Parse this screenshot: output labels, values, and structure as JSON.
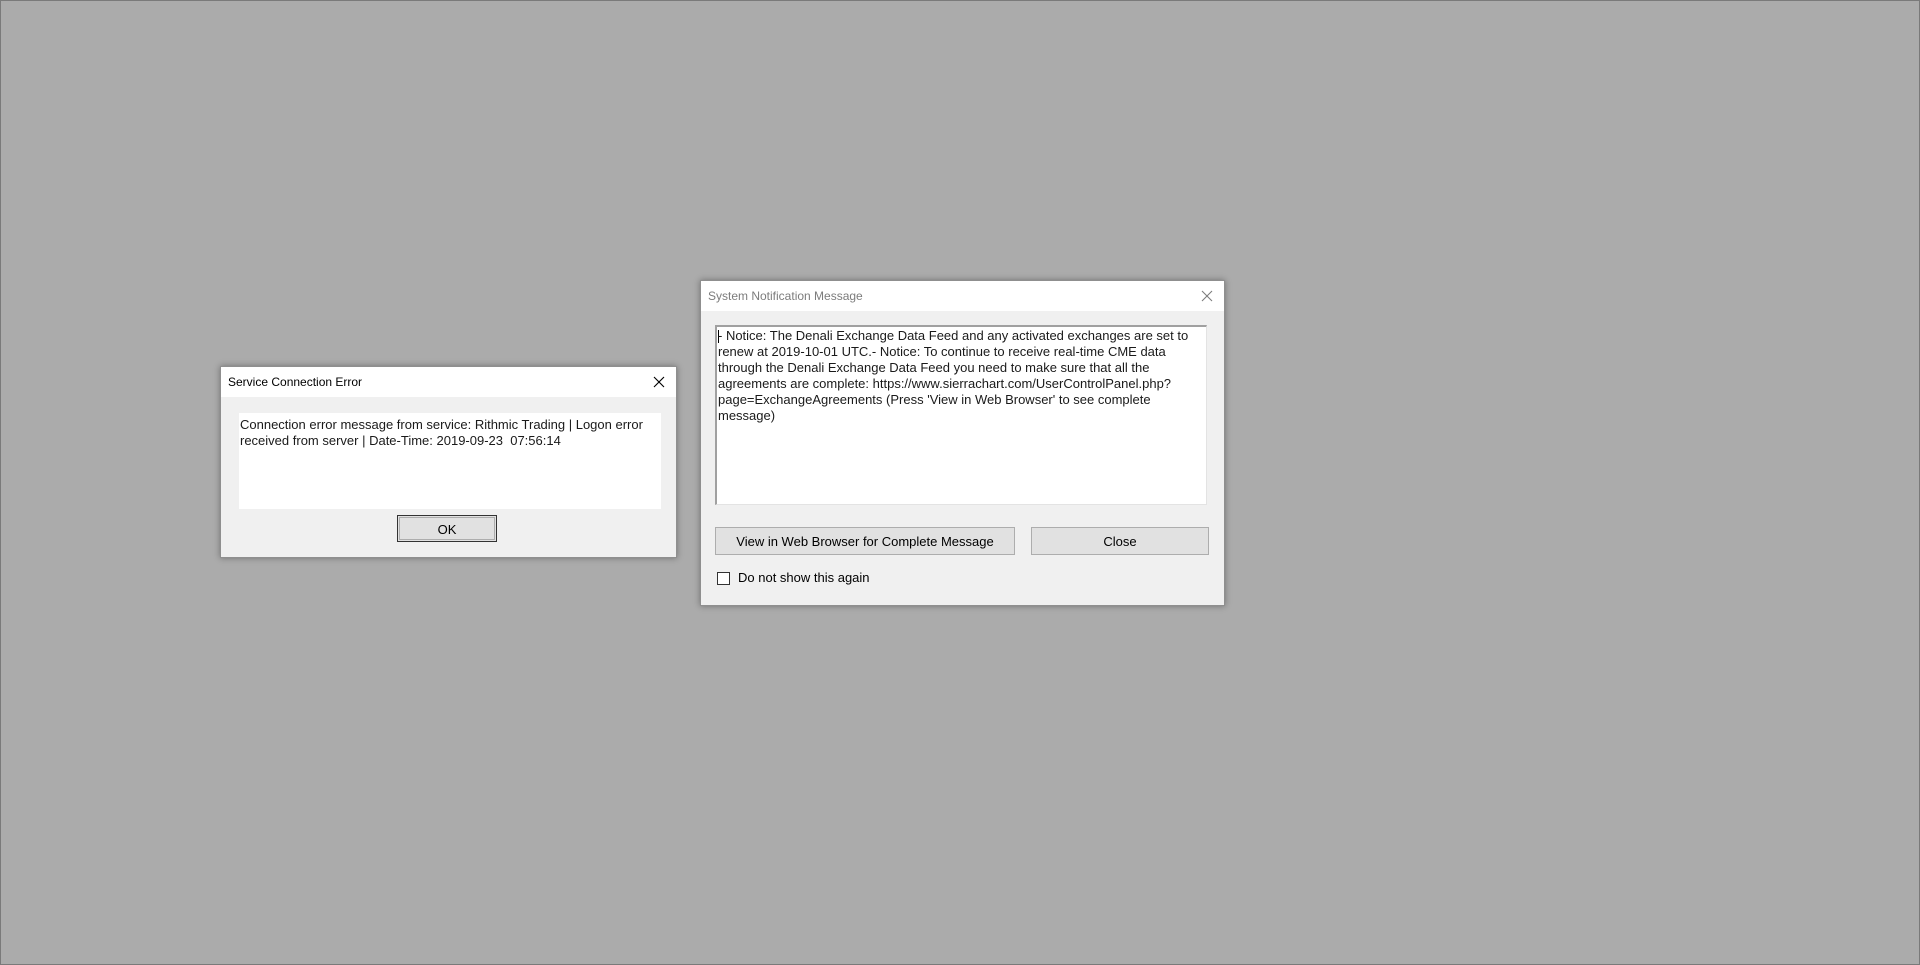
{
  "error_dialog": {
    "title": "Service Connection Error",
    "message": "Connection error message from service: Rithmic Trading | Logon error received from server | Date-Time: 2019-09-23  07:56:14",
    "ok_label": "OK",
    "close_icon": "close-icon"
  },
  "notice_dialog": {
    "title": "System Notification Message",
    "message": "- Notice: The Denali Exchange Data Feed and any activated exchanges are set to renew at 2019-10-01 UTC.- Notice: To continue to receive real-time CME data through the Denali Exchange Data Feed you need to make sure that all the agreements are complete: https://www.sierrachart.com/UserControlPanel.php?page=ExchangeAgreements (Press 'View in Web Browser' to see complete message)",
    "view_web_label": "View in Web Browser for Complete Message",
    "close_label": "Close",
    "checkbox_label": "Do not show this again",
    "checkbox_checked": false,
    "close_icon": "close-icon"
  },
  "colors": {
    "desktop_background": "#ababab",
    "dialog_background": "#f0f0f0",
    "inactive_title": "#7c7c7c"
  }
}
